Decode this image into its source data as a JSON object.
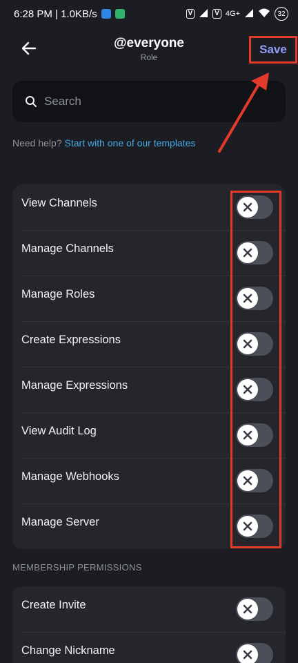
{
  "status_bar": {
    "time_info": "6:28 PM | 1.0KB/s",
    "network": "4G+",
    "battery": "32"
  },
  "header": {
    "title": "@everyone",
    "subtitle": "Role",
    "save_label": "Save"
  },
  "search": {
    "placeholder": "Search",
    "value": ""
  },
  "help": {
    "prefix": "Need help?",
    "link": "Start with one of our templates"
  },
  "general_permissions": [
    {
      "label": "View Channels",
      "enabled": false
    },
    {
      "label": "Manage Channels",
      "enabled": false
    },
    {
      "label": "Manage Roles",
      "enabled": false
    },
    {
      "label": "Create Expressions",
      "enabled": false
    },
    {
      "label": "Manage Expressions",
      "enabled": false
    },
    {
      "label": "View Audit Log",
      "enabled": false
    },
    {
      "label": "Manage Webhooks",
      "enabled": false
    },
    {
      "label": "Manage Server",
      "enabled": false
    }
  ],
  "membership_section": {
    "heading": "MEMBERSHIP PERMISSIONS",
    "permissions": [
      {
        "label": "Create Invite",
        "enabled": false
      },
      {
        "label": "Change Nickname",
        "enabled": false
      }
    ]
  },
  "colors": {
    "background": "#1c1d22",
    "card": "#25262c",
    "accent": "#949cf7",
    "link": "#46a9e6",
    "annotation": "#e23b2b"
  }
}
